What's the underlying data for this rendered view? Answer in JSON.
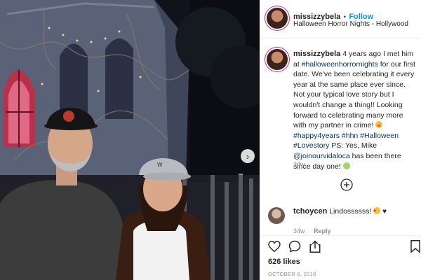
{
  "post": {
    "username": "missizzybela",
    "separator": "•",
    "follow_label": "Follow",
    "location": "Halloween Horror Nights - Hollywood"
  },
  "caption": {
    "username": "missizzybela",
    "part1": "4 years ago I met him at",
    "tag_hhn_long": "#halloweenhorrornights",
    "part2": "for our first date. We've been celebrating it every year at the same place ever since. Not your typical love story but I wouldn't change a thing!! Looking forward to celebrating many more with my partner in crime!",
    "tag_years": "#happy4years",
    "tag_hhn": "#hhn",
    "tag_halloween": "#Halloween",
    "tag_lovestory": "#Lovestory",
    "part3": "PS: Yes, Mike",
    "mention": "@joinourvidaloca",
    "part4": "has been there since day one!",
    "age": "34w"
  },
  "comment": {
    "username": "tchoycen",
    "text": "Lindossssss!",
    "age": "34w",
    "reply_label": "Reply"
  },
  "footer": {
    "likes": "626 likes",
    "date": "OCTOBER 6, 2018"
  },
  "icons": {
    "next": "chevron-right-icon",
    "load_more": "plus-circle-icon",
    "like": "heart-icon",
    "comment": "comment-icon",
    "share": "share-icon",
    "save": "bookmark-icon"
  },
  "colors": {
    "follow": "#0095f6",
    "hashtag": "#00376b",
    "muted": "#8e8e8e"
  }
}
